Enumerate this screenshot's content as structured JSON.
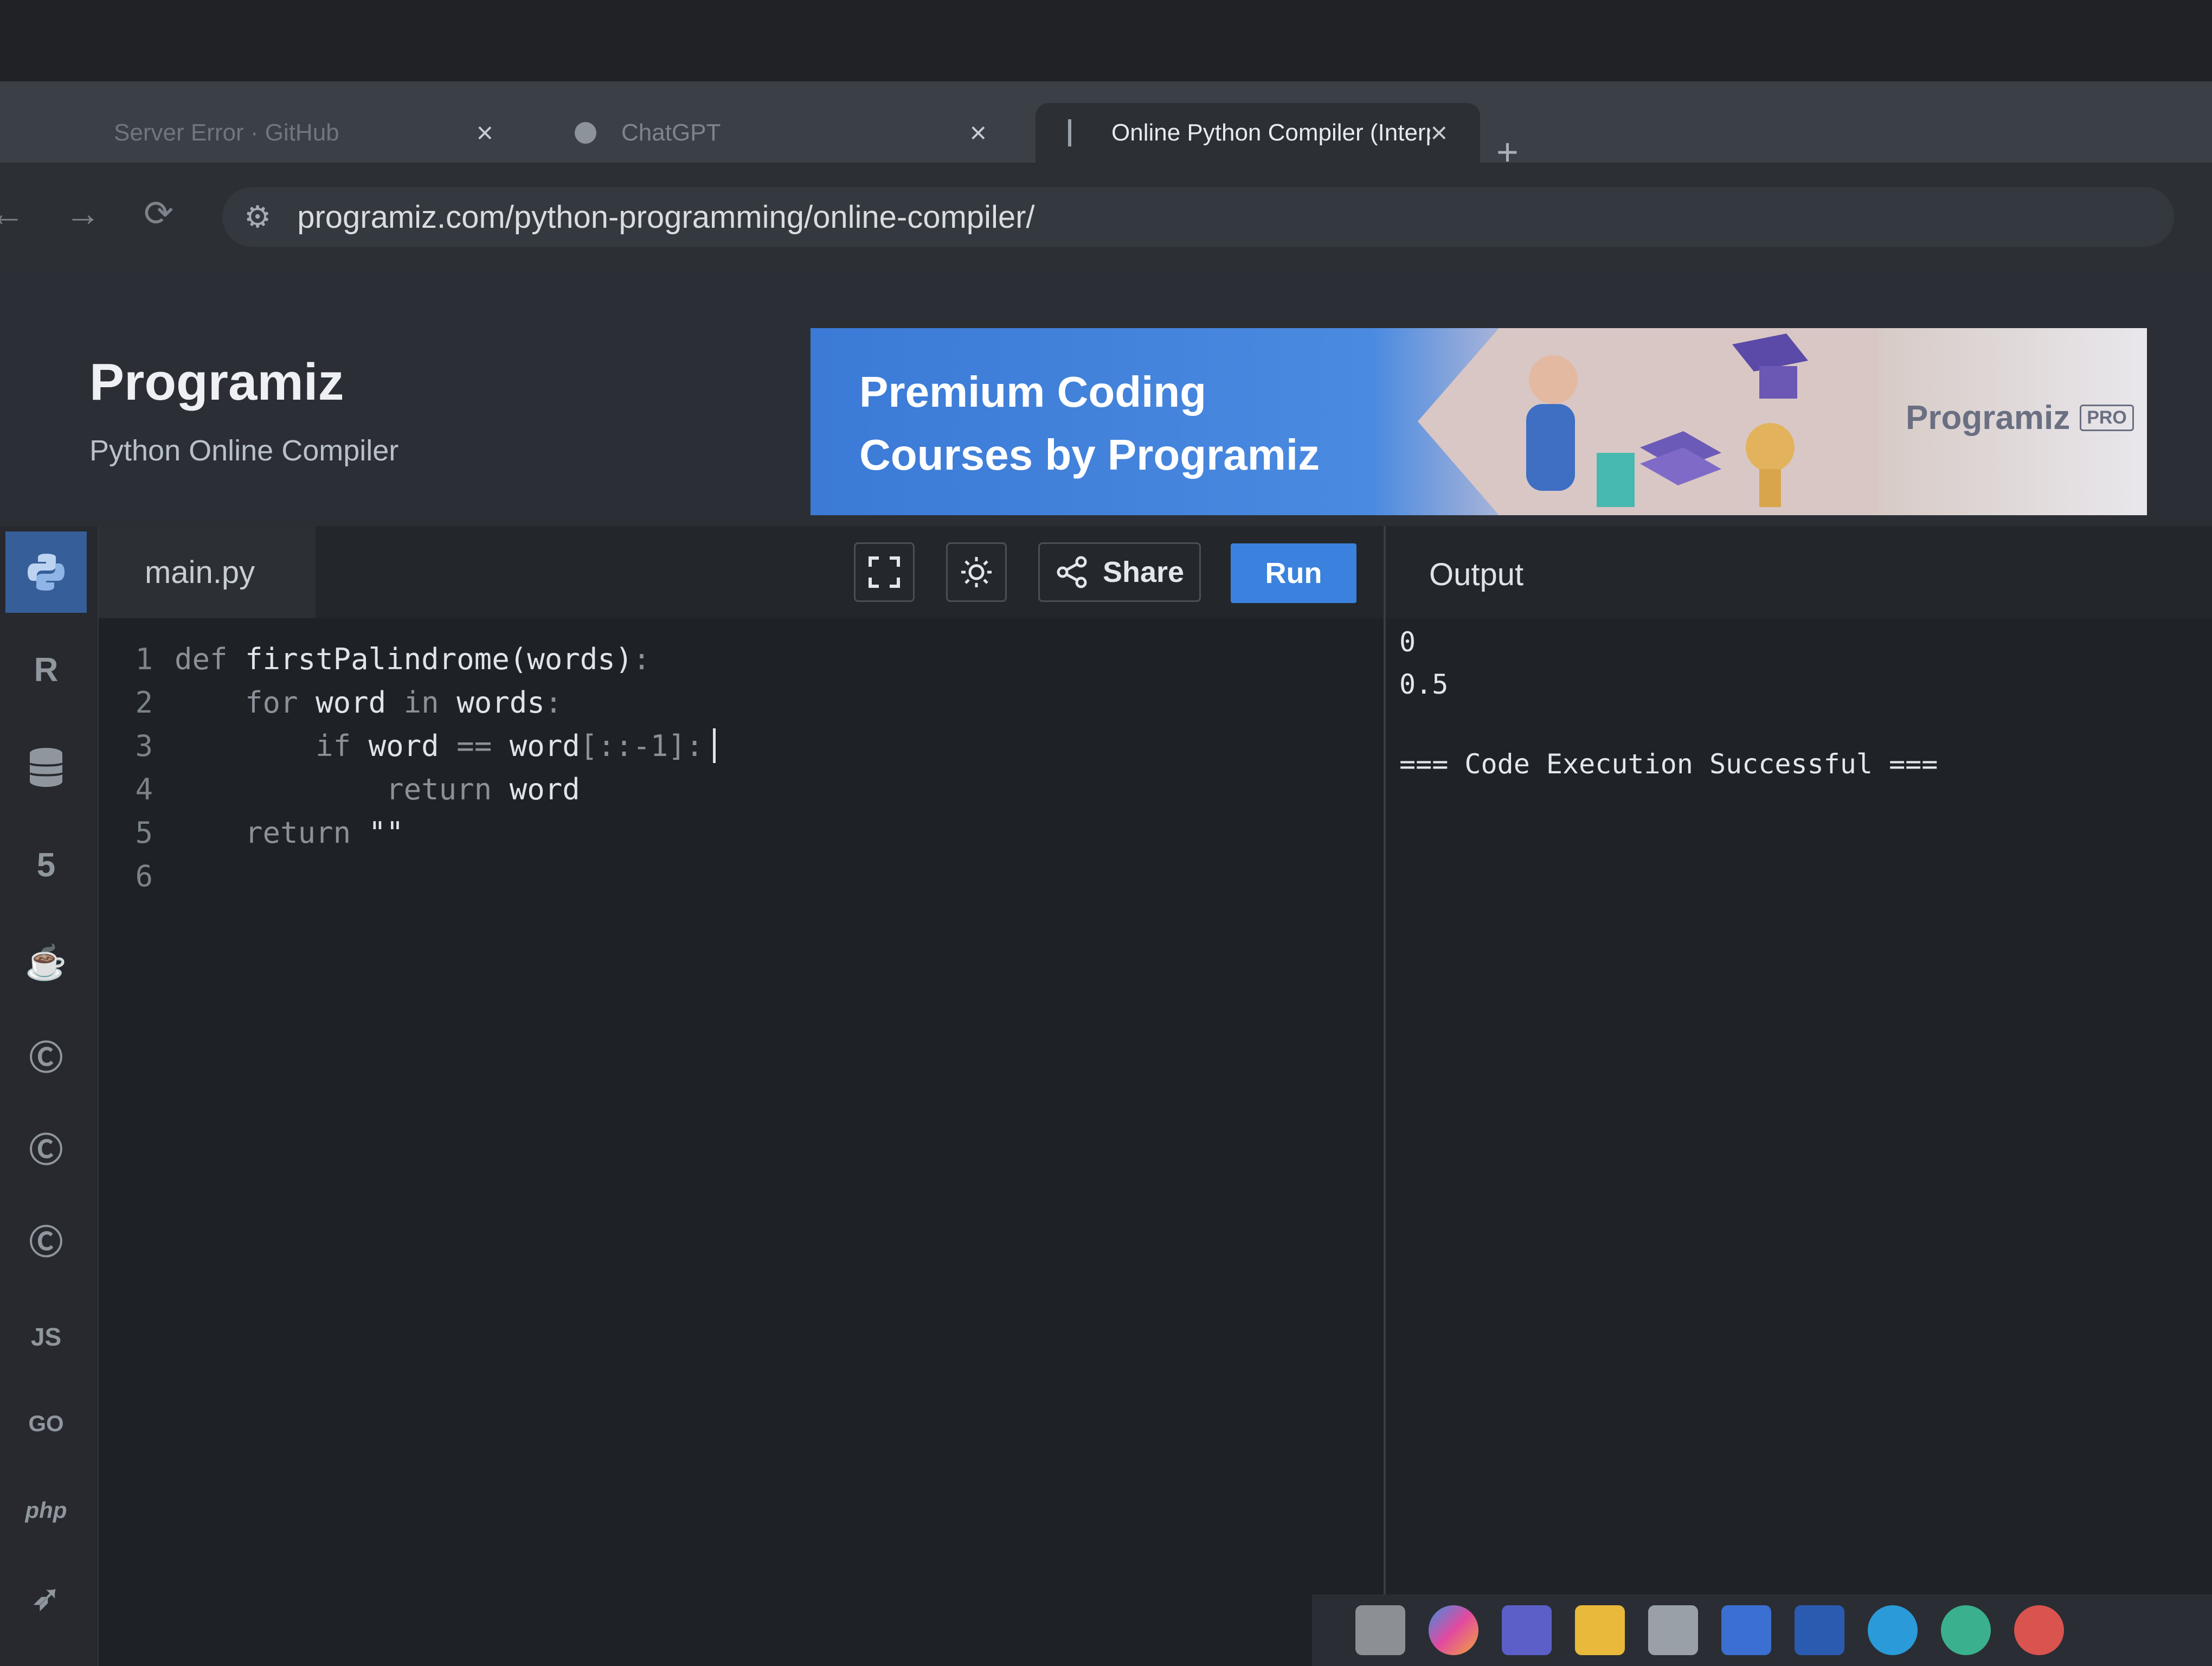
{
  "browser": {
    "tabs": [
      {
        "title": "Server Error · GitHub",
        "close": "×"
      },
      {
        "title": "ChatGPT",
        "close": "×"
      },
      {
        "title": "Online Python Compiler (Interp",
        "close": "×"
      }
    ],
    "new_tab": "+",
    "url": "programiz.com/python-programming/online-compiler/"
  },
  "site": {
    "logo": "Programiz",
    "subtitle": "Python Online Compiler"
  },
  "ad": {
    "line1": "Premium Coding",
    "line2": "Courses by Programiz",
    "brand": "Programiz",
    "badge": "PRO"
  },
  "sidebar": {
    "items": [
      {
        "icon": "python-icon",
        "active": true
      },
      {
        "icon": "r-icon"
      },
      {
        "icon": "database-icon"
      },
      {
        "icon": "html5-icon"
      },
      {
        "icon": "java-icon"
      },
      {
        "icon": "c-icon"
      },
      {
        "icon": "cpp-icon"
      },
      {
        "icon": "csharp-icon"
      },
      {
        "icon": "js-icon",
        "label": "JS"
      },
      {
        "icon": "go-icon",
        "label": "GO"
      },
      {
        "icon": "php-icon",
        "label": "php"
      },
      {
        "icon": "swift-icon"
      }
    ]
  },
  "editor": {
    "filename": "main.py",
    "share_label": "Share",
    "run_label": "Run",
    "lines": [
      {
        "n": "1",
        "code": "def firstPalindrome(words):"
      },
      {
        "n": "2",
        "code": "    for word in words:"
      },
      {
        "n": "3",
        "code": "        if word == word[::-1]:"
      },
      {
        "n": "4",
        "code": "            return word"
      },
      {
        "n": "5",
        "code": "    return \"\""
      },
      {
        "n": "6",
        "code": ""
      }
    ]
  },
  "output": {
    "title": "Output",
    "lines": [
      "0",
      "0.5",
      "",
      "=== Code Execution Successful ==="
    ]
  },
  "colors": {
    "run_button": "#3a82dd",
    "sidebar_active": "#365f99",
    "ad_blue": "#3b7ad6"
  }
}
